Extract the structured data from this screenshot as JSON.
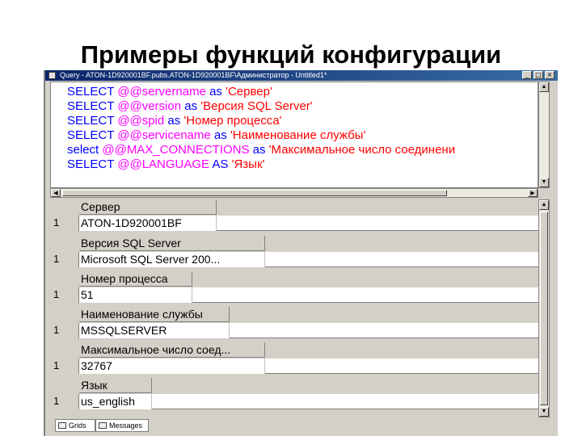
{
  "slide": {
    "title": "Примеры функций конфигурации"
  },
  "window": {
    "title": "Query - ATON-1D920001BF.pubs.ATON-1D920001BF\\Администратор - Untitled1*",
    "buttons": [
      "_",
      "□",
      "×"
    ]
  },
  "query": {
    "lines": [
      {
        "kw": "SELECT ",
        "var": "@@servername",
        "as": " as ",
        "alias": "'Сервер'"
      },
      {
        "kw": "SELECT ",
        "var": "@@version",
        "as": " as ",
        "alias": "'Версия  SQL Server'"
      },
      {
        "kw": "SELECT ",
        "var": "@@spid",
        "as": " as ",
        "alias": "'Номер процесса'"
      },
      {
        "kw": "SELECT ",
        "var": "@@servicename",
        "as": " as ",
        "alias": "'Наименование службы'"
      },
      {
        "kw": "select ",
        "var": "@@MAX_CONNECTIONS",
        "as": " as ",
        "alias": "'Максимальное число соединени"
      },
      {
        "kw": "SELECT ",
        "var": "@@LANGUAGE",
        "as": " AS ",
        "alias": "'Язык'"
      }
    ]
  },
  "results": [
    {
      "header": "Сервер",
      "row": "1",
      "value": "ATON-1D920001BF"
    },
    {
      "header": "Версия  SQL Server",
      "row": "1",
      "value": "Microsoft SQL Server  200..."
    },
    {
      "header": "Номер процесса",
      "row": "1",
      "value": "51"
    },
    {
      "header": "Наименование службы",
      "row": "1",
      "value": "MSSQLSERVER"
    },
    {
      "header": "Максимальное число соед...",
      "row": "1",
      "value": "32767"
    },
    {
      "header": "Язык",
      "row": "1",
      "value": "us_english"
    }
  ],
  "tabs": {
    "grids": "Grids",
    "messages": "Messages"
  }
}
